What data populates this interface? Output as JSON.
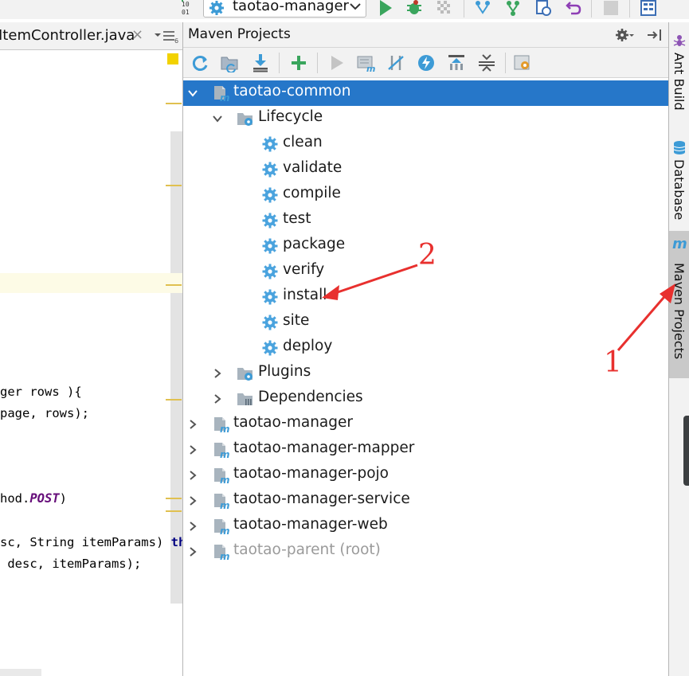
{
  "toolbar": {
    "run_config": "taotao-manager",
    "icons": [
      "binary-icon",
      "gear-icon",
      "chevron-down-icon",
      "run-icon",
      "debug-icon",
      "coverage-icon",
      "vcs-update-icon",
      "vcs-commit-icon",
      "vcs-history-icon",
      "revert-icon",
      "stop-icon",
      "project-structure-icon"
    ]
  },
  "editor": {
    "tab_title": "ItemController.java",
    "tab_close": "×",
    "code": {
      "line1": "ger rows ){",
      "line2": "page, rows);",
      "line3_text": "hod.",
      "line3_italic": "POST",
      "line3_end": ")",
      "line4_text": "sc, String itemParams) ",
      "line4_kw": "thr",
      "line5": " desc, itemParams);"
    }
  },
  "maven": {
    "title": "Maven Projects",
    "header_icons": [
      "settings-gear-icon",
      "hide-panel-icon"
    ],
    "toolbar_icons": [
      "reimport-icon",
      "generate-sources-icon",
      "download-icon",
      "add-icon",
      "run-goal-icon",
      "execute-goal-icon",
      "toggle-offline-icon",
      "skip-tests-icon",
      "show-dependencies-icon",
      "expand-all-icon",
      "collapse-all-icon",
      "maven-settings-icon"
    ],
    "tree": [
      {
        "label": "taotao-common",
        "type": "module",
        "expanded": true,
        "selected": true,
        "level": 0
      },
      {
        "label": "Lifecycle",
        "type": "folder",
        "expanded": true,
        "level": 1
      },
      {
        "label": "clean",
        "type": "goal",
        "level": 2
      },
      {
        "label": "validate",
        "type": "goal",
        "level": 2
      },
      {
        "label": "compile",
        "type": "goal",
        "level": 2
      },
      {
        "label": "test",
        "type": "goal",
        "level": 2
      },
      {
        "label": "package",
        "type": "goal",
        "level": 2
      },
      {
        "label": "verify",
        "type": "goal",
        "level": 2
      },
      {
        "label": "install",
        "type": "goal",
        "level": 2
      },
      {
        "label": "site",
        "type": "goal",
        "level": 2
      },
      {
        "label": "deploy",
        "type": "goal",
        "level": 2
      },
      {
        "label": "Plugins",
        "type": "folder",
        "expanded": false,
        "level": 1
      },
      {
        "label": "Dependencies",
        "type": "deps",
        "expanded": false,
        "level": 1
      },
      {
        "label": "taotao-manager",
        "type": "module",
        "expanded": false,
        "level": 0
      },
      {
        "label": "taotao-manager-mapper",
        "type": "module",
        "expanded": false,
        "level": 0
      },
      {
        "label": "taotao-manager-pojo",
        "type": "module",
        "expanded": false,
        "level": 0
      },
      {
        "label": "taotao-manager-service",
        "type": "module",
        "expanded": false,
        "level": 0
      },
      {
        "label": "taotao-manager-web",
        "type": "module",
        "expanded": false,
        "level": 0
      },
      {
        "label": "taotao-parent (root)",
        "type": "module",
        "expanded": false,
        "level": 0,
        "muted": true
      }
    ]
  },
  "right_tabs": {
    "ant_build": "Ant Build",
    "database": "Database",
    "maven_projects": "Maven Projects"
  },
  "annotations": {
    "mark1": "1",
    "mark2": "2"
  },
  "colors": {
    "selection": "#2677c9",
    "annotation": "#e8302e",
    "maven_blue": "#3d9bd6",
    "run_green": "#3aa55d"
  }
}
